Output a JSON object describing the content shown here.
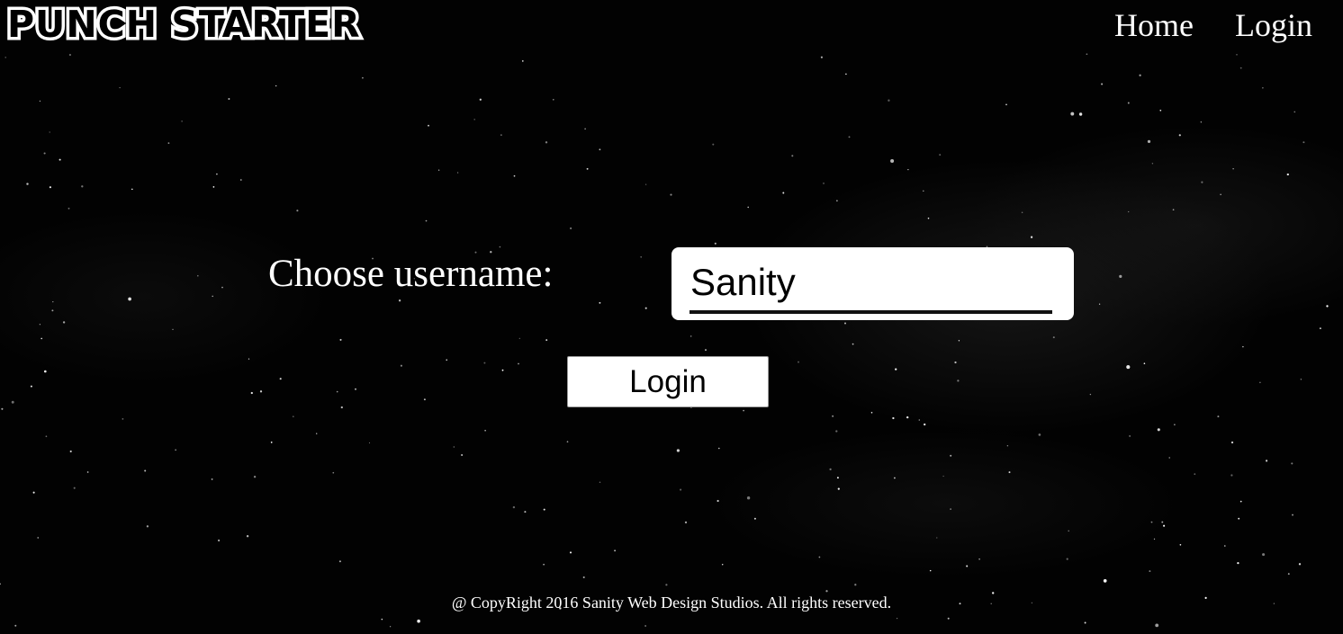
{
  "header": {
    "logo_text": "PUNCH STARTER",
    "nav": [
      {
        "label": "Home"
      },
      {
        "label": "Login"
      }
    ]
  },
  "form": {
    "username_label": "Choose username:",
    "username_value": "Sanity",
    "submit_label": "Login"
  },
  "footer": {
    "copyright": "@ CopyRight 2016 Sanity Web Design Studios. All rights reserved."
  },
  "colors": {
    "background": "#000000",
    "text": "#ffffff",
    "field_background": "#ffffff"
  }
}
